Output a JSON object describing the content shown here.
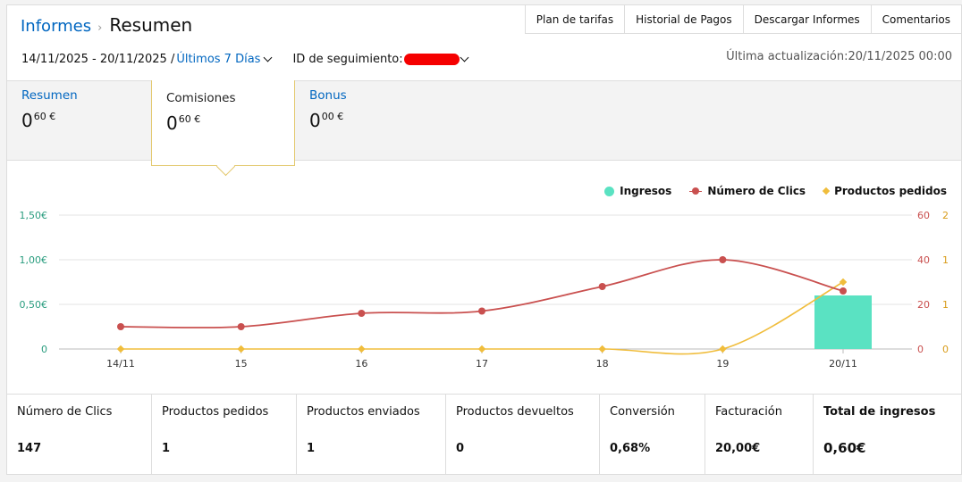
{
  "breadcrumb": {
    "parent": "Informes",
    "current": "Resumen"
  },
  "toplinks": [
    "Plan de tarifas",
    "Historial de Pagos",
    "Descargar Informes",
    "Comentarios"
  ],
  "filters": {
    "date_range": "14/11/2025 - 20/11/2025 /",
    "range_label": "Últimos 7 Días",
    "tracking_label": "ID de seguimiento:"
  },
  "last_update": "Última actualización:20/11/2025 00:00",
  "summary": [
    {
      "label": "Resumen",
      "int": "0",
      "dec": "60 €"
    },
    {
      "label": "Comisiones",
      "int": "0",
      "dec": "60 €"
    },
    {
      "label": "Bonus",
      "int": "0",
      "dec": "00 €"
    }
  ],
  "legend": [
    {
      "label": "Ingresos",
      "color": "#5ae2c2",
      "marker": "dot"
    },
    {
      "label": "Número de Clics",
      "color": "#c9504f",
      "marker": "line-dot"
    },
    {
      "label": "Productos pedidos",
      "color": "#f0bd3c",
      "marker": "diamond"
    }
  ],
  "chart_data": {
    "type": "bar+line",
    "categories": [
      "14/11",
      "15",
      "16",
      "17",
      "18",
      "19",
      "20/11"
    ],
    "y_left": {
      "ticks": [
        "0",
        "0,50€",
        "1,00€",
        "1,50€"
      ],
      "range": [
        0,
        1.5
      ],
      "color": "#2a9d7f"
    },
    "y_right_clicks": {
      "ticks": [
        "0",
        "20",
        "40",
        "60"
      ],
      "range": [
        0,
        60
      ],
      "color": "#c9504f"
    },
    "y_right_orders": {
      "ticks": [
        "0",
        "1",
        "1",
        "2"
      ],
      "range": [
        0,
        2
      ],
      "color": "#d89c1a"
    },
    "series": [
      {
        "name": "Ingresos",
        "type": "bar",
        "axis": "left",
        "color": "#5ae2c2",
        "values": [
          0,
          0,
          0,
          0,
          0,
          0,
          0.6
        ]
      },
      {
        "name": "Número de Clics",
        "type": "line",
        "axis": "clicks",
        "color": "#c9504f",
        "values": [
          10,
          10,
          16,
          17,
          28,
          40,
          26
        ]
      },
      {
        "name": "Productos pedidos",
        "type": "line",
        "axis": "orders",
        "color": "#f0bd3c",
        "values": [
          0,
          0,
          0,
          0,
          0,
          0,
          1
        ]
      }
    ],
    "grid": true,
    "legend_position": "top-right"
  },
  "stats": [
    {
      "label": "Número de Clics",
      "value": "147"
    },
    {
      "label": "Productos pedidos",
      "value": "1"
    },
    {
      "label": "Productos enviados",
      "value": "1"
    },
    {
      "label": "Productos devueltos",
      "value": "0"
    },
    {
      "label": "Conversión",
      "value": "0,68%"
    },
    {
      "label": "Facturación",
      "value": "20,00€"
    },
    {
      "label": "Total de ingresos",
      "value": "0,60€"
    }
  ]
}
